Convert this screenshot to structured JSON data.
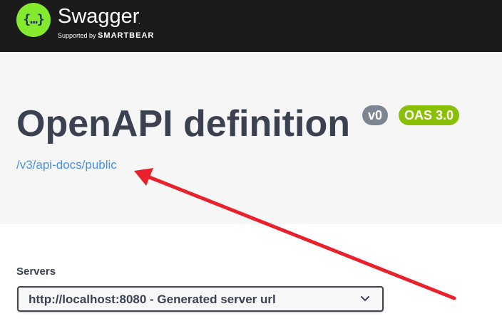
{
  "header": {
    "logo_icon": "swagger-logo-icon",
    "logo_glyph": "{…}",
    "brand_name": "Swagger",
    "brand_tm": ".",
    "supported_by": "Supported by",
    "supported_by_brand": "SMARTBEAR",
    "background_color": "#1b1b1b",
    "logo_color": "#85ea2d"
  },
  "info": {
    "title": "OpenAPI definition",
    "version_badge": "v0",
    "oas_badge": "OAS 3.0",
    "spec_link": "/v3/api-docs/public",
    "link_color": "#4990e2",
    "oas_badge_color": "#89bf04",
    "version_badge_color": "#7d8492"
  },
  "servers": {
    "label": "Servers",
    "selected": "http://localhost:8080 - Generated server url"
  },
  "annotation": {
    "arrow_color": "#e8212c"
  }
}
